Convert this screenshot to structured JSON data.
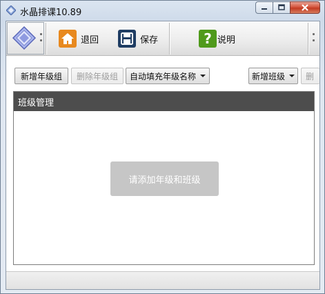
{
  "window": {
    "title": "水晶排课10.89",
    "icon": "crystal-diamond-icon"
  },
  "toolbar": {
    "back": {
      "label": "退回",
      "icon": "home-icon",
      "color": "#e8891f"
    },
    "save": {
      "label": "保存",
      "icon": "floppy-disk-icon",
      "color": "#1f3d63"
    },
    "help": {
      "label": "说明",
      "icon": "question-icon",
      "color": "#4f9a1b"
    }
  },
  "actions": {
    "add_grade_group": "新增年级组",
    "delete_grade_group": "删除年级组",
    "autofill_grade_name": "自动填充年级名称",
    "add_class": "新增班级",
    "more": "删"
  },
  "panel": {
    "title": "班级管理",
    "empty_hint": "请添加年级和班级"
  },
  "colors": {
    "panel_header_bg": "#4d4d4d",
    "placeholder_bg": "#c6c6c6",
    "close_button": "#c23b22"
  }
}
